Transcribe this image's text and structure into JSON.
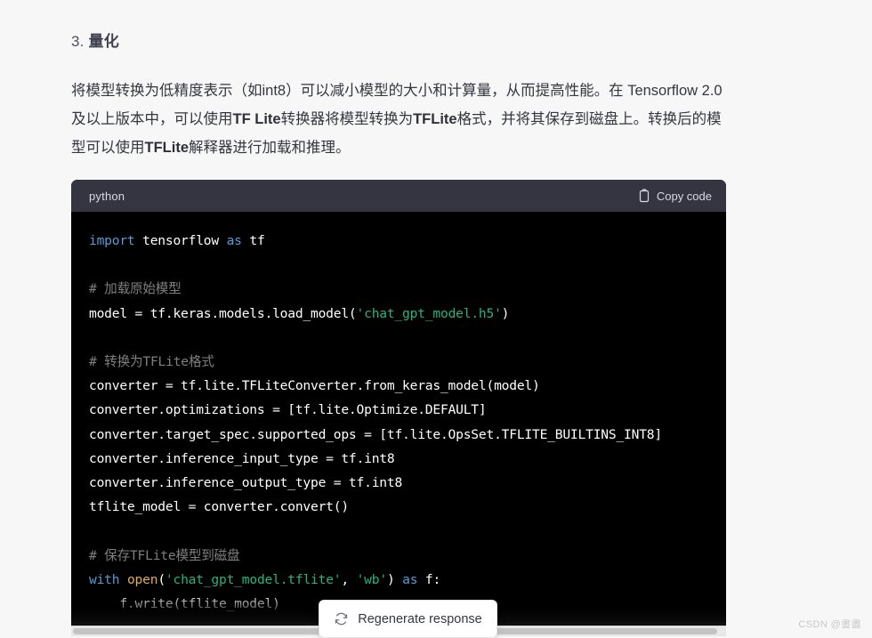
{
  "heading": {
    "number": "3.",
    "text": "量化"
  },
  "paragraph": {
    "line1_a": "将模型转换为低精度表示（如int8）可以减小模型的大小和计算量，从而提高性能。在",
    "line2_a": "Tensorflow 2.0及以上版本中，可以使用",
    "line2_b": "TF Lite",
    "line2_c": "转换器将模型转换为",
    "line2_d": "TFLite",
    "line2_e": "格式，并将其保存",
    "line3_a": "到磁盘上。转换后的模型可以使用",
    "line3_b": "TFLite",
    "line3_c": "解释器进行加载和推理。"
  },
  "codeblock": {
    "language": "python",
    "copy_label": "Copy code",
    "copy_icon": "clipboard-icon",
    "lines": [
      [
        {
          "t": "import",
          "c": "t-kw"
        },
        {
          "t": " tensorflow ",
          "c": "t-pl"
        },
        {
          "t": "as",
          "c": "t-kw"
        },
        {
          "t": " tf",
          "c": "t-pl"
        }
      ],
      [],
      [
        {
          "t": "# 加载原始模型",
          "c": "t-cmt"
        }
      ],
      [
        {
          "t": "model = tf.keras.models.load_model(",
          "c": "t-pl"
        },
        {
          "t": "'chat_gpt_model.h5'",
          "c": "t-str"
        },
        {
          "t": ")",
          "c": "t-pl"
        }
      ],
      [],
      [
        {
          "t": "# 转换为TFLite格式",
          "c": "t-cmt"
        }
      ],
      [
        {
          "t": "converter = tf.lite.TFLiteConverter.from_keras_model(model)",
          "c": "t-pl"
        }
      ],
      [
        {
          "t": "converter.optimizations = [tf.lite.Optimize.DEFAULT]",
          "c": "t-pl"
        }
      ],
      [
        {
          "t": "converter.target_spec.supported_ops = [tf.lite.OpsSet.TFLITE_BUILTINS_INT8]",
          "c": "t-pl"
        }
      ],
      [
        {
          "t": "converter.inference_input_type = tf.int8",
          "c": "t-pl"
        }
      ],
      [
        {
          "t": "converter.inference_output_type = tf.int8",
          "c": "t-pl"
        }
      ],
      [
        {
          "t": "tflite_model = converter.convert()",
          "c": "t-pl"
        }
      ],
      [],
      [
        {
          "t": "# 保存TFLite模型到磁盘",
          "c": "t-cmt"
        }
      ],
      [
        {
          "t": "with",
          "c": "t-kw"
        },
        {
          "t": " ",
          "c": "t-pl"
        },
        {
          "t": "open",
          "c": "t-fn"
        },
        {
          "t": "(",
          "c": "t-pl"
        },
        {
          "t": "'chat_gpt_model.tflite'",
          "c": "t-str"
        },
        {
          "t": ", ",
          "c": "t-pl"
        },
        {
          "t": "'wb'",
          "c": "t-str"
        },
        {
          "t": ") ",
          "c": "t-pl"
        },
        {
          "t": "as",
          "c": "t-kw"
        },
        {
          "t": " f:",
          "c": "t-pl"
        }
      ],
      [
        {
          "t": "    f.write(tflite_model)",
          "c": "t-pl"
        }
      ]
    ]
  },
  "regenerate": {
    "label": "Regenerate response",
    "icon": "refresh-icon"
  },
  "watermark": {
    "text": "CSDN @書盡"
  },
  "colors": {
    "page_background": "#f7f7f8",
    "code_background": "#000000",
    "code_header_background": "#343541",
    "keyword": "#569cd6",
    "string": "#24b47e",
    "comment": "#7f7f7f",
    "function": "#dcad5a",
    "body_text": "#353740"
  }
}
